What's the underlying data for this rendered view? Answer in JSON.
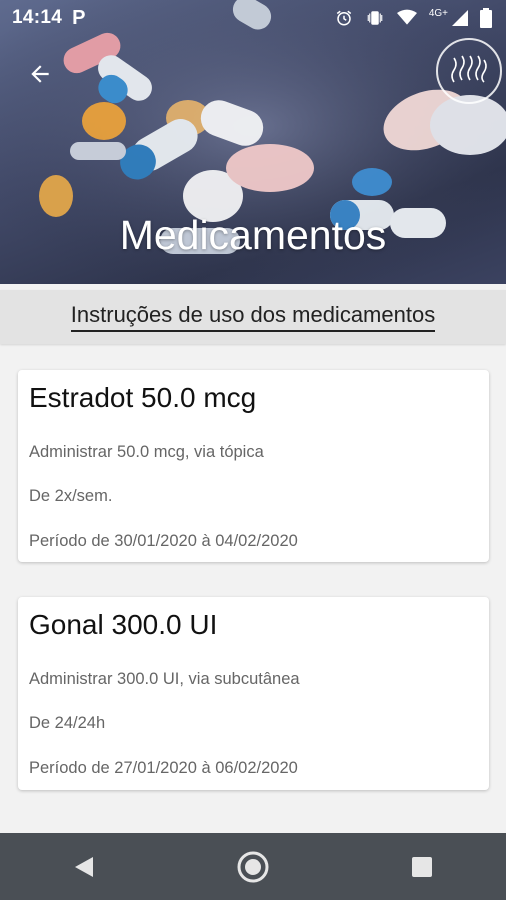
{
  "status_bar": {
    "time": "14:14",
    "notification_icon": "p-icon",
    "network_label": "4G+",
    "icons": [
      "alarm-icon",
      "vibrate-icon",
      "wifi-icon",
      "signal-icon",
      "battery-icon"
    ]
  },
  "header": {
    "title": "Medicamentos",
    "back_icon": "arrow-left-icon",
    "logo": "clinic-logo"
  },
  "subheader": {
    "title": "Instruções de uso dos medicamentos"
  },
  "medications": [
    {
      "name": "Estradot 50.0 mcg",
      "administration": "Administrar 50.0 mcg, via tópica",
      "frequency": "De 2x/sem.",
      "period": "Período de 30/01/2020  à 04/02/2020"
    },
    {
      "name": "Gonal 300.0 UI",
      "administration": "Administrar 300.0 UI, via subcutânea",
      "frequency": "De 24/24h",
      "period": "Período de 27/01/2020  à 06/02/2020"
    }
  ],
  "navbar": {
    "buttons": [
      "back-triangle-icon",
      "home-circle-icon",
      "recents-square-icon"
    ]
  },
  "colors": {
    "navbar": "#4a4f55",
    "subheader_bg": "#e3e3e3",
    "page_bg": "#f2f2f2"
  }
}
